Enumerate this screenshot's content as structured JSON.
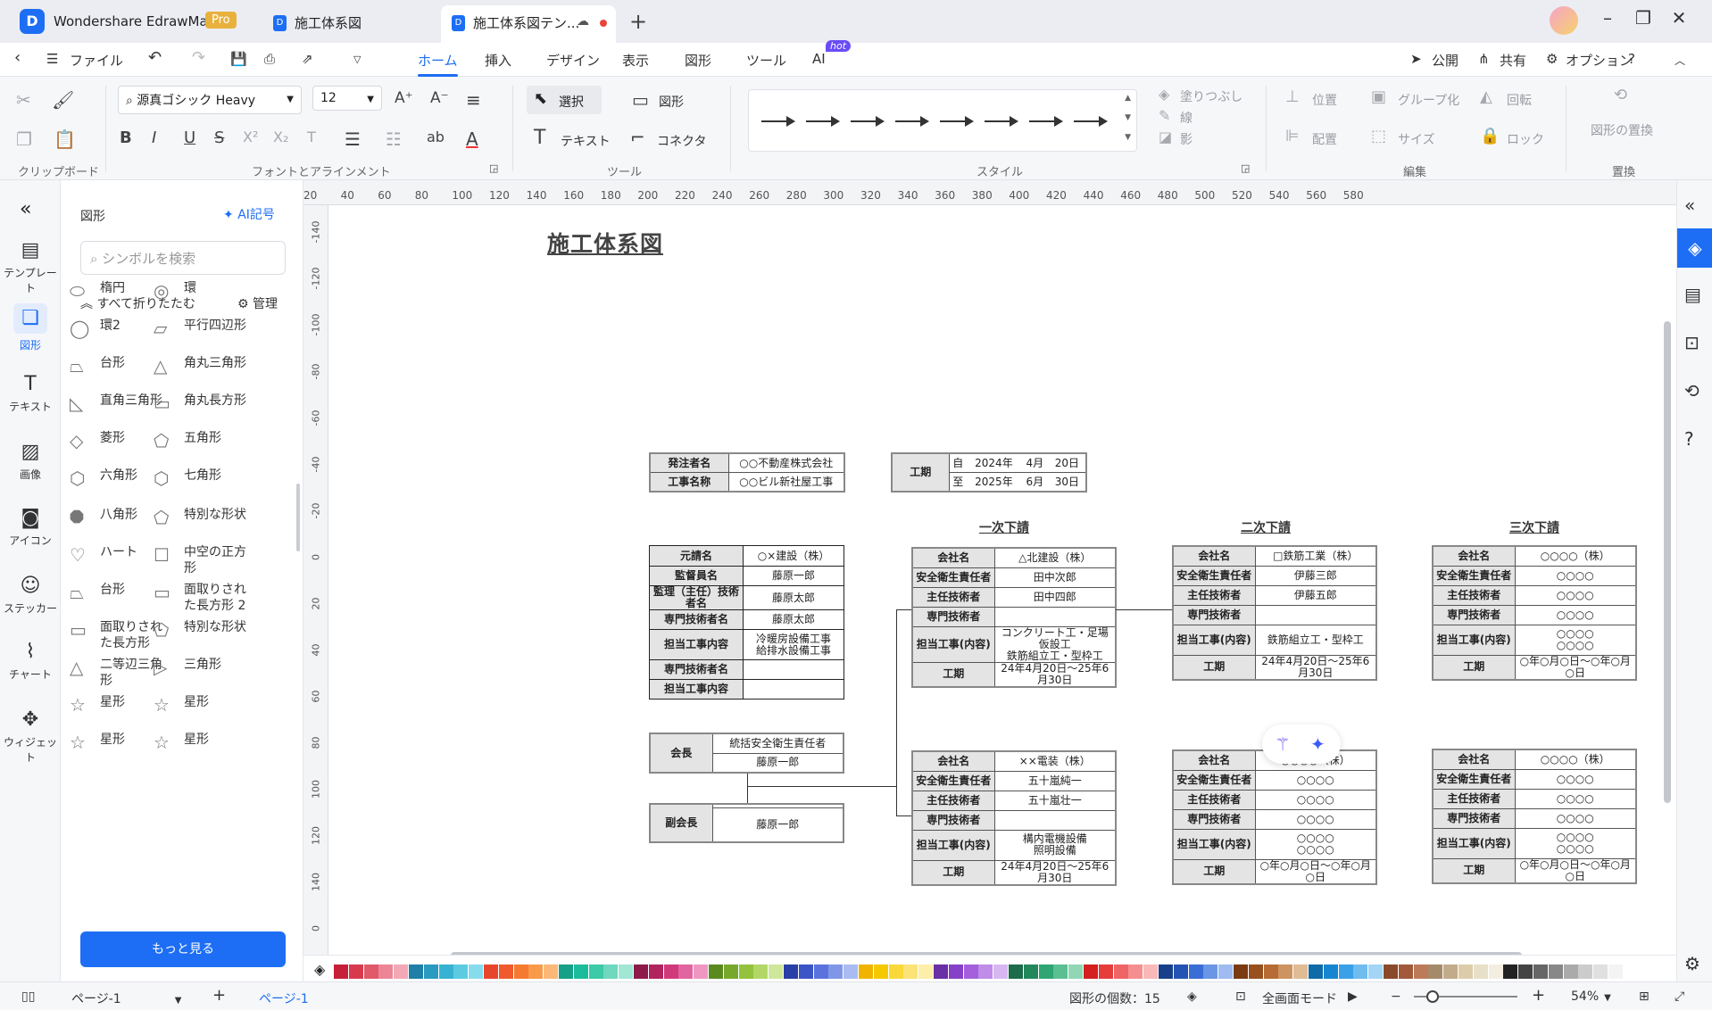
{
  "app": {
    "name": "Wondershare EdrawMax",
    "badge": "Pro"
  },
  "tabs": [
    {
      "label": "施工体系図"
    },
    {
      "label": "施工体系図テン..."
    }
  ],
  "menu": {
    "file": "ファイル",
    "tabs": [
      "ホーム",
      "挿入",
      "デザイン",
      "表示",
      "図形",
      "ツール",
      "AI"
    ],
    "ai_badge": "hot",
    "publish": "公開",
    "share": "共有",
    "options": "オプション"
  },
  "ribbon": {
    "font_name": "源真ゴシック Heavy",
    "font_size": "12",
    "select": "選択",
    "shape": "図形",
    "text": "テキスト",
    "connector": "コネクタ",
    "fill": "塗りつぶし",
    "line": "線",
    "shadow": "影",
    "position": "位置",
    "group": "グループ化",
    "rotate": "回転",
    "align": "配置",
    "size": "サイズ",
    "lock": "ロック",
    "replace": "図形の置換",
    "groups": {
      "clipboard": "クリップボード",
      "font": "フォントとアラインメント",
      "tools": "ツール",
      "style": "スタイル",
      "edit": "編集",
      "replace": "置換"
    }
  },
  "leftrail": [
    {
      "label": "テンプレート",
      "icon": "template-icon"
    },
    {
      "label": "図形",
      "icon": "shapes-icon"
    },
    {
      "label": "テキスト",
      "icon": "text-icon"
    },
    {
      "label": "画像",
      "icon": "image-icon"
    },
    {
      "label": "アイコン",
      "icon": "icon-icon"
    },
    {
      "label": "ステッカー",
      "icon": "sticker-icon"
    },
    {
      "label": "チャート",
      "icon": "chart-icon"
    },
    {
      "label": "ウィジェット",
      "icon": "widget-icon"
    }
  ],
  "panel": {
    "title": "図形",
    "ai_symbol": "AI記号",
    "search_placeholder": "シンボルを検索",
    "collapse_all": "すべて折りたたむ",
    "manage": "管理",
    "more": "もっと見る",
    "shapes": [
      "楕円",
      "環",
      "環2",
      "平行四辺形",
      "台形",
      "角丸三角形",
      "直角三角形",
      "角丸長方形",
      "菱形",
      "五角形",
      "六角形",
      "七角形",
      "八角形",
      "特別な形状",
      "ハート",
      "中空の正方形",
      "台形",
      "面取りされた長方形 2",
      "面取りされた長方形",
      "特別な形状",
      "二等辺三角形",
      "三角形",
      "星形",
      "星形",
      "星形",
      "星形"
    ]
  },
  "ruler": {
    "h": [
      "20",
      "40",
      "60",
      "80",
      "100",
      "120",
      "140",
      "160",
      "180",
      "200",
      "220",
      "240",
      "260",
      "280",
      "300",
      "320",
      "340",
      "360",
      "380",
      "400",
      "420",
      "440",
      "460",
      "480",
      "500",
      "520",
      "540",
      "560",
      "580"
    ],
    "v": [
      "-160",
      "-140",
      "-120",
      "-100",
      "-80",
      "-60",
      "-40",
      "-20",
      "0",
      "20",
      "40",
      "60",
      "80",
      "100",
      "120",
      "140",
      "0"
    ]
  },
  "diagram": {
    "title": "施工体系図",
    "owner": [
      [
        "発注者名",
        "○○不動産株式会社"
      ],
      [
        "工事名称",
        "○○ビル新社屋工事"
      ]
    ],
    "period": {
      "label": "工期",
      "rows": [
        [
          "自",
          "2024年",
          "4月",
          "20日"
        ],
        [
          "至",
          "2025年",
          "6月",
          "30日"
        ]
      ]
    },
    "prime": [
      [
        "元請名",
        "○×建設（株）"
      ],
      [
        "監督員名",
        "藤原一郎"
      ],
      [
        "監理（主任）技術者名",
        "藤原太郎"
      ],
      [
        "専門技術者名",
        "藤原太郎"
      ],
      [
        "担当工事内容",
        "冷暖房設備工事\n給排水設備工事"
      ],
      [
        "専門技術者名",
        ""
      ],
      [
        "担当工事内容",
        ""
      ]
    ],
    "committee": {
      "chair": "会長",
      "chair_role": "統括安全衛生責任者",
      "chair_name": "藤原一郎",
      "vice": "副会長",
      "vice_role": "",
      "vice_name": "藤原一郎"
    },
    "sections": [
      "一次下請",
      "二次下請",
      "三次下請"
    ],
    "labels": [
      "会社名",
      "安全衛生責任者",
      "主任技術者",
      "専門技術者",
      "担当工事(内容)",
      "工期"
    ],
    "subs": {
      "t1a": [
        "△北建設（株）",
        "田中次郎",
        "田中四郎",
        "",
        "コンクリート工・足場仮設工\n鉄筋組立工・型枠工",
        "24年4月20日～25年6月30日"
      ],
      "t2a": [
        "□鉄筋工業（株）",
        "伊藤三郎",
        "伊藤五郎",
        "",
        "鉄筋組立工・型枠工",
        "24年4月20日～25年6月30日"
      ],
      "t3a": [
        "○○○○（株）",
        "○○○○",
        "○○○○",
        "○○○○",
        "○○○○\n○○○○",
        "○年○月○日～○年○月○日"
      ],
      "t1b": [
        "××電装（株）",
        "五十嵐純一",
        "五十嵐壮一",
        "",
        "構内電機設備\n照明設備",
        "24年4月20日～25年6月30日"
      ],
      "t2b": [
        "○○○○（株）",
        "○○○○",
        "○○○○",
        "○○○○",
        "○○○○\n○○○○",
        "○年○月○日～○年○月○日"
      ],
      "t3b": [
        "○○○○（株）",
        "○○○○",
        "○○○○",
        "○○○○",
        "○○○○\n○○○○",
        "○年○月○日～○年○月○日"
      ]
    }
  },
  "palette": [
    "#c61f3a",
    "#d83a4d",
    "#e05a6a",
    "#ee8597",
    "#f3a8b5",
    "#1f7fa6",
    "#2a9ac0",
    "#38b2d2",
    "#5ccbe2",
    "#86dcec",
    "#e8462c",
    "#f05a2c",
    "#f57a30",
    "#f99a4a",
    "#fbb877",
    "#16a085",
    "#1abc9c",
    "#3ccaa8",
    "#6fd8bf",
    "#a2e6d4",
    "#8e1a4a",
    "#b2245e",
    "#d03a7a",
    "#e165a0",
    "#ef97c1",
    "#5a8a1f",
    "#78a82b",
    "#94c23d",
    "#b2d766",
    "#cfe79b",
    "#2a3ea8",
    "#3b55c6",
    "#5a73dc",
    "#8097e8",
    "#a9bbf2",
    "#f0b400",
    "#f6c800",
    "#f9d83a",
    "#fbe377",
    "#fdeea9",
    "#6b2fa6",
    "#8740c8",
    "#a45fdc",
    "#bf8ce8",
    "#d7b6f2",
    "#1c6b4a",
    "#23875c",
    "#2ea573",
    "#5cbf92",
    "#91d6b5",
    "#d42020",
    "#e63c3c",
    "#ef6464",
    "#f58f8f",
    "#fab8b8",
    "#1a3f8a",
    "#2453b3",
    "#3a6ed6",
    "#6b96e6",
    "#9fbbf1",
    "#7a3a12",
    "#98501e",
    "#b66c34",
    "#cc9461",
    "#e0bb94",
    "#0f6aa8",
    "#1585d1",
    "#3aa0e8",
    "#6fbcef",
    "#a3d5f6",
    "#8a4a2a",
    "#a25a3a",
    "#bd7a58",
    "#a58a6a",
    "#c2ab8a",
    "#dcccaa",
    "#e8dfc8",
    "#f3eee0",
    "#222222",
    "#444444",
    "#666666",
    "#888888",
    "#aaaaaa",
    "#cccccc",
    "#e0e0e0",
    "#f4f4f4"
  ],
  "status": {
    "page_selector": "ページ-1",
    "page_tab": "ページ-1",
    "shape_count": "図形の個数：15",
    "fullscreen": "全画面モード",
    "zoom": "54%"
  }
}
